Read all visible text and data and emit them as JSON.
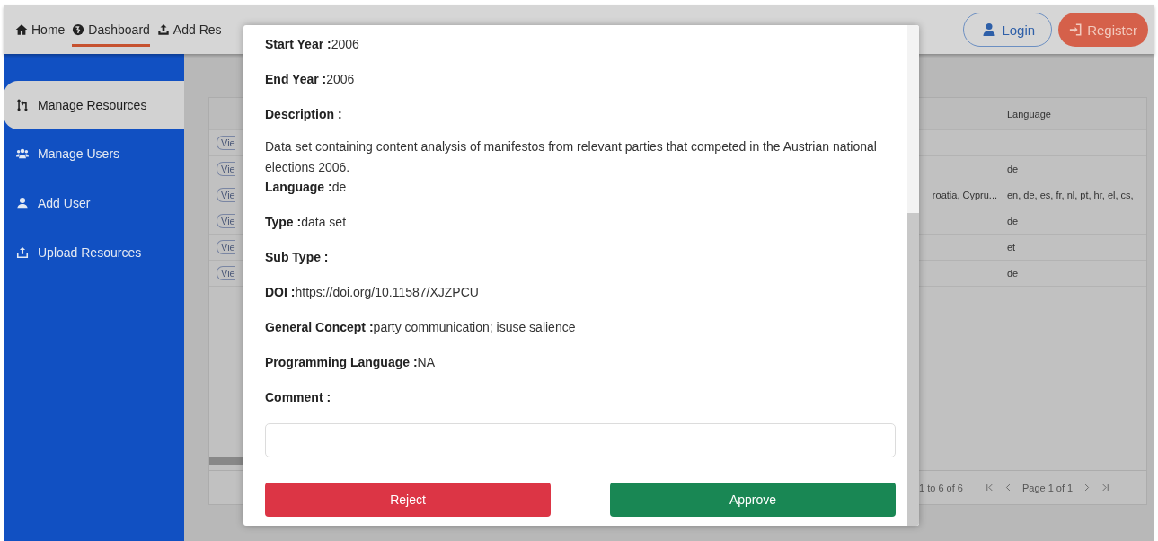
{
  "nav": {
    "items": [
      {
        "label": "Home",
        "selected": false
      },
      {
        "label": "Dashboard",
        "selected": true
      },
      {
        "label": "Add Res",
        "selected": false
      }
    ],
    "login": "Login",
    "register": "Register"
  },
  "sidebar": {
    "items": [
      {
        "label": "Manage Resources",
        "selected": true
      },
      {
        "label": "Manage Users",
        "selected": false
      },
      {
        "label": "Add User",
        "selected": false
      },
      {
        "label": "Upload Resources",
        "selected": false
      }
    ]
  },
  "table": {
    "columns": [
      {
        "label": "Language"
      }
    ],
    "rows": [
      {
        "action": "Vie"
      },
      {
        "action": "Vie",
        "language": "de"
      },
      {
        "action": "Vie",
        "column_3": "roatia, Cypru...",
        "language": "en, de, es, fr, nl, pt, hr, el, cs,"
      },
      {
        "action": "Vie",
        "language": "de"
      },
      {
        "action": "Vie",
        "language": "et"
      },
      {
        "action": "Vie",
        "language": "de"
      }
    ],
    "pagination": {
      "summary": "1 to 6 of 6",
      "page": "Page 1 of 1"
    }
  },
  "modal": {
    "fields": [
      {
        "kind": "inline",
        "label": "Start Year :",
        "value": "2006"
      },
      {
        "kind": "inline",
        "label": "End Year :",
        "value": "2006"
      },
      {
        "kind": "block",
        "label": "Description :",
        "value": "Data set containing content analysis of manifestos from relevant parties that competed in the Austrian national elections 2006."
      },
      {
        "kind": "inline",
        "label": "Language :",
        "value": "de"
      },
      {
        "kind": "inline",
        "label": "Type :",
        "value": "data set"
      },
      {
        "kind": "inline",
        "label": "Sub Type :"
      },
      {
        "kind": "inline",
        "label": "DOI :",
        "value": "https://doi.org/10.11587/XJZPCU"
      },
      {
        "kind": "inline",
        "label": "General Concept :",
        "value": "party communication; isuse salience"
      },
      {
        "kind": "inline",
        "label": "Programming Language :",
        "value": "NA"
      }
    ],
    "comment": {
      "label": "Comment :"
    },
    "buttons": [
      {
        "kind": "danger",
        "label": "Reject"
      },
      {
        "kind": "success",
        "label": "Approve"
      }
    ]
  }
}
